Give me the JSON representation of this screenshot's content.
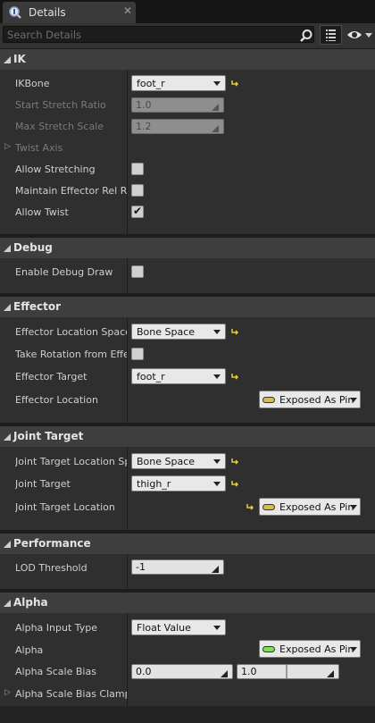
{
  "tab": {
    "title": "Details",
    "close": "✕"
  },
  "search": {
    "placeholder": "Search Details",
    "value": ""
  },
  "colors": {
    "pin_yellow": "#d8c03a",
    "pin_green": "#7ee05a",
    "accent_reset": "#e2cf3a"
  },
  "sections": {
    "ik": {
      "title": "IK",
      "ikbone_label": "IKBone",
      "ikbone_value": "foot_r",
      "start_stretch_label": "Start Stretch Ratio",
      "start_stretch_value": "1.0",
      "max_stretch_label": "Max Stretch Scale",
      "max_stretch_value": "1.2",
      "twist_axis_label": "Twist Axis",
      "allow_stretching_label": "Allow Stretching",
      "allow_stretching_checked": false,
      "maintain_label": "Maintain Effector Rel Rot",
      "maintain_checked": false,
      "allow_twist_label": "Allow Twist",
      "allow_twist_checked": true
    },
    "debug": {
      "title": "Debug",
      "enable_debug_label": "Enable Debug Draw",
      "enable_debug_checked": false
    },
    "effector": {
      "title": "Effector",
      "loc_space_label": "Effector Location Space",
      "loc_space_value": "Bone Space",
      "take_rotation_label": "Take Rotation from Effec",
      "take_rotation_checked": false,
      "target_label": "Effector Target",
      "target_value": "foot_r",
      "location_label": "Effector Location",
      "location_pin": "Exposed As Pin"
    },
    "joint": {
      "title": "Joint Target",
      "loc_space_label": "Joint Target Location Spa",
      "loc_space_value": "Bone Space",
      "target_label": "Joint Target",
      "target_value": "thigh_r",
      "location_label": "Joint Target Location",
      "location_pin": "Exposed As Pin"
    },
    "performance": {
      "title": "Performance",
      "lod_label": "LOD Threshold",
      "lod_value": "-1"
    },
    "alpha": {
      "title": "Alpha",
      "input_type_label": "Alpha Input Type",
      "input_type_value": "Float Value",
      "alpha_label": "Alpha",
      "alpha_pin": "Exposed As Pin",
      "scale_bias_label": "Alpha Scale Bias",
      "scale_bias_min": "0.0",
      "scale_bias_max": "1.0",
      "scale_bias_clamp_label": "Alpha Scale Bias Clamp"
    }
  }
}
